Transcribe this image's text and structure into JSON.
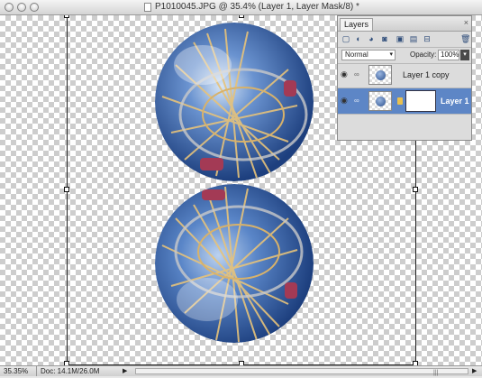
{
  "window": {
    "title": "P1010045.JPG @ 35.4% (Layer 1, Layer Mask/8) *"
  },
  "layers_panel": {
    "tab_label": "Layers",
    "close_glyph": "×",
    "tools": [
      "new-layer-icon",
      "adjustment-icon",
      "fill-icon",
      "mask-icon",
      "lock-icon",
      "lock-all-icon",
      "merge-icon",
      "trash-icon"
    ],
    "blend_mode": "Normal",
    "opacity_label": "Opacity:",
    "opacity_value": "100%",
    "layers": [
      {
        "name": "Layer 1 copy",
        "visible": true,
        "selected": false,
        "has_mask": false
      },
      {
        "name": "Layer 1",
        "visible": true,
        "selected": true,
        "has_mask": true
      }
    ]
  },
  "status": {
    "zoom": "35.35%",
    "doc_size": "Doc: 14.1M/26.0M"
  },
  "colors": {
    "selection": "#5d86c6",
    "sky": "#3d6bb7",
    "spoke": "#e6c27a"
  }
}
